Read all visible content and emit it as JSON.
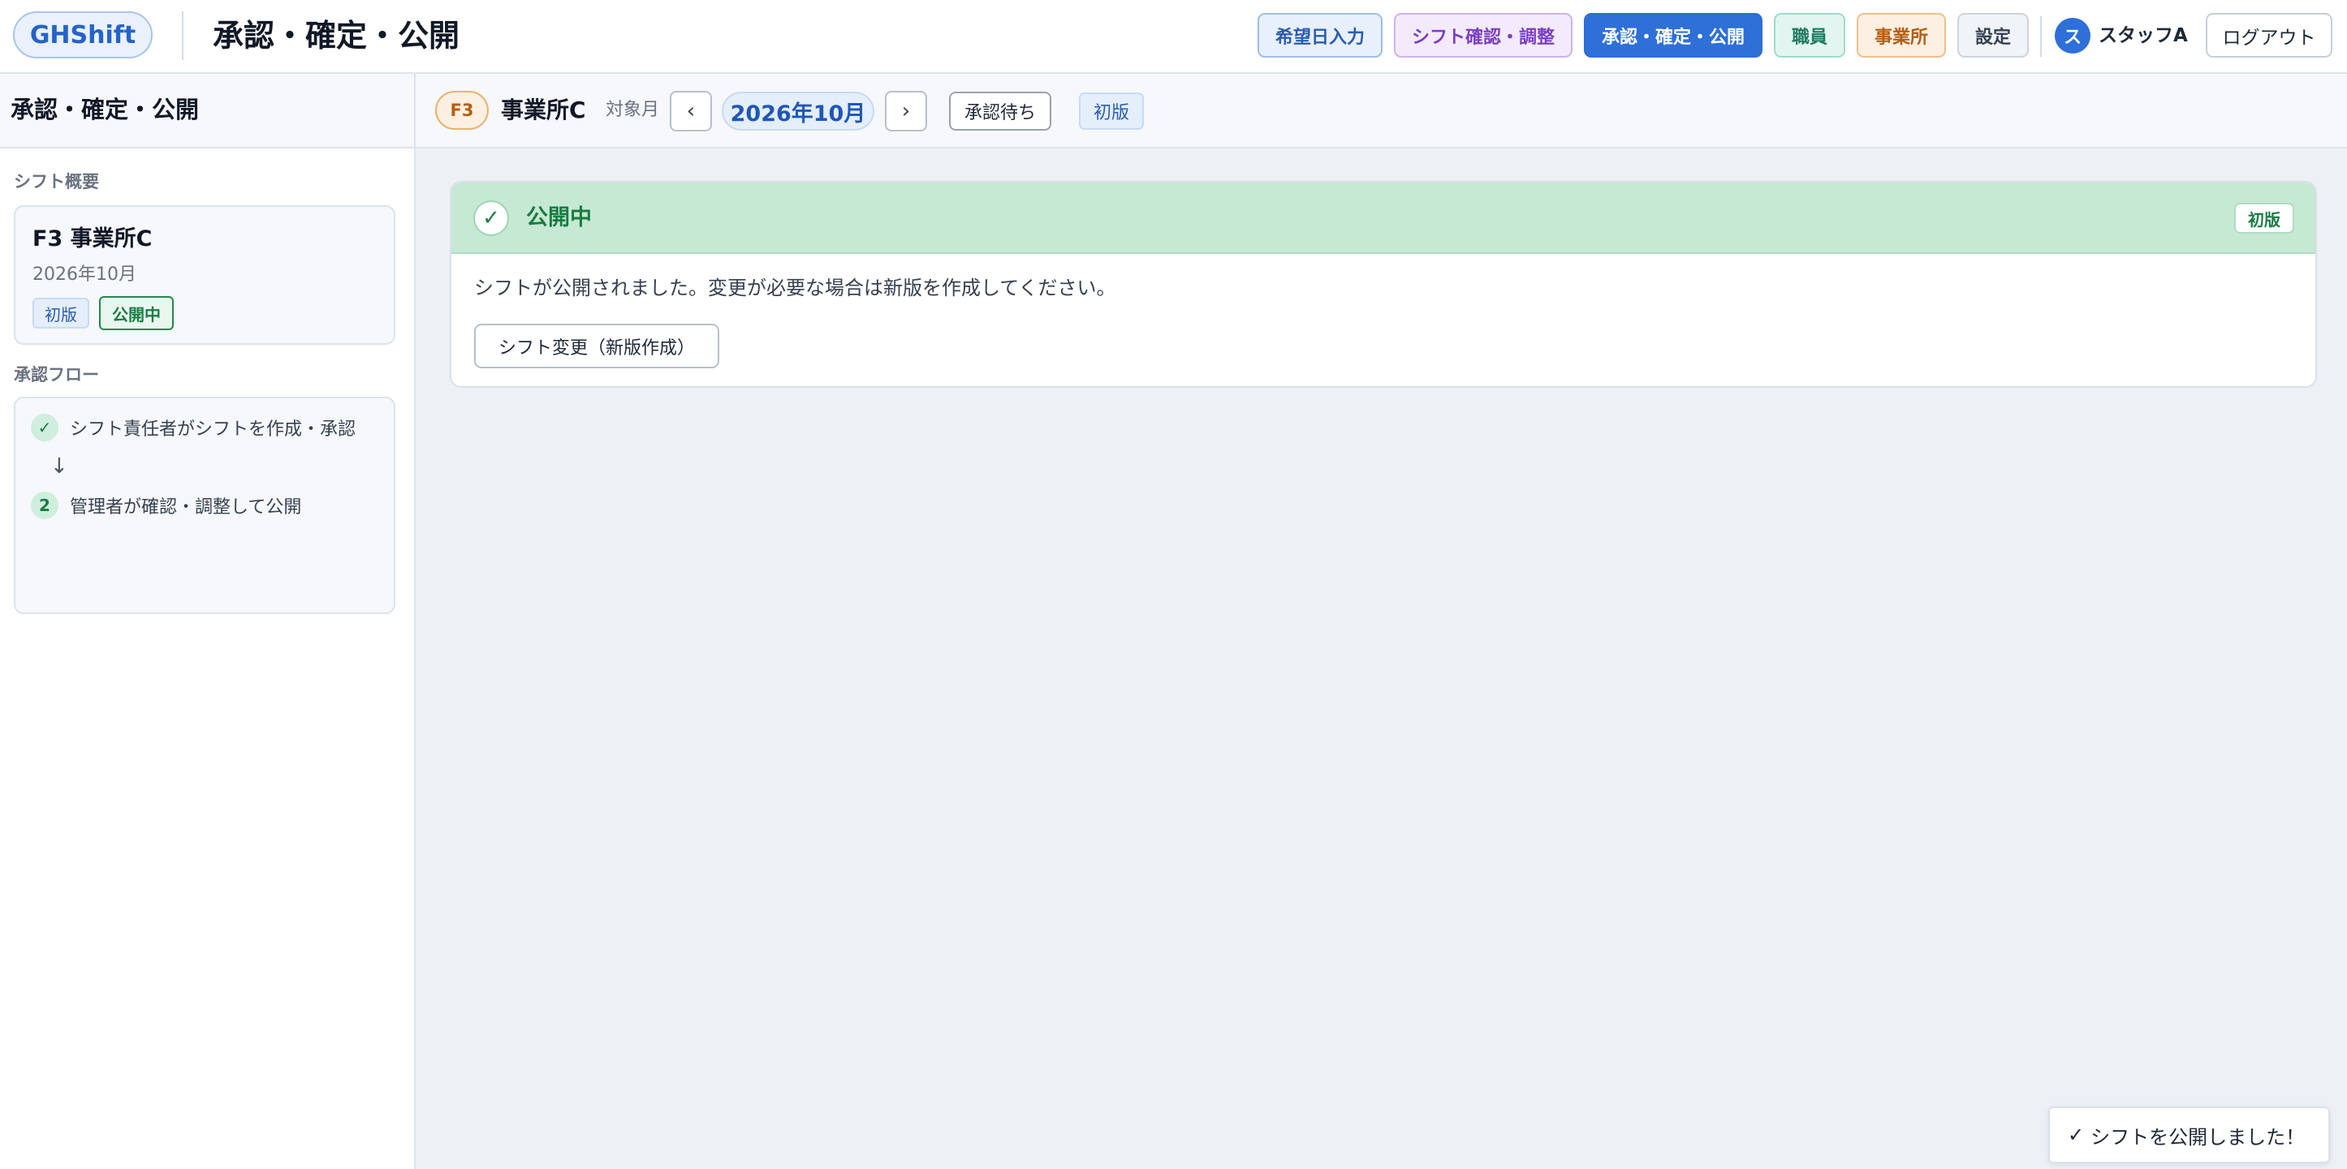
{
  "header": {
    "logo": "GHShift",
    "title": "承認・確定・公開",
    "nav": {
      "wish": "希望日入力",
      "shift": "シフト確認・調整",
      "approve": "承認・確定・公開",
      "staff": "職員",
      "office": "事業所",
      "settings": "設定"
    },
    "user_initial": "ス",
    "user_name": "スタッフA",
    "logout": "ログアウト"
  },
  "sidebar": {
    "title": "承認・確定・公開",
    "summary_label": "シフト概要",
    "summary": {
      "name": "F3 事業所C",
      "month": "2026年10月",
      "version": "初版",
      "status": "公開中"
    },
    "flow_label": "承認フロー",
    "flow": {
      "step1_icon": "✓",
      "step1": "シフト責任者がシフトを作成・承認",
      "arrow": "↓",
      "step2_num": "2",
      "step2": "管理者が確認・調整して公開"
    }
  },
  "toolbar": {
    "office_code": "F3",
    "office_name": "事業所C",
    "month_label": "対象月",
    "prev": "‹",
    "month": "2026年10月",
    "next": "›",
    "pending": "承認待ち",
    "version": "初版"
  },
  "status_card": {
    "check": "✓",
    "title": "公開中",
    "version": "初版",
    "message": "シフトが公開されました。変更が必要な場合は新版を作成してください。",
    "new_version_button": "シフト変更（新版作成）"
  },
  "toast": {
    "icon": "✓",
    "message": "シフトを公開しました！"
  },
  "colors": {
    "accent": "#2e6fd8",
    "published_green": "#1a7c43",
    "published_bg": "#c6e9d4"
  }
}
